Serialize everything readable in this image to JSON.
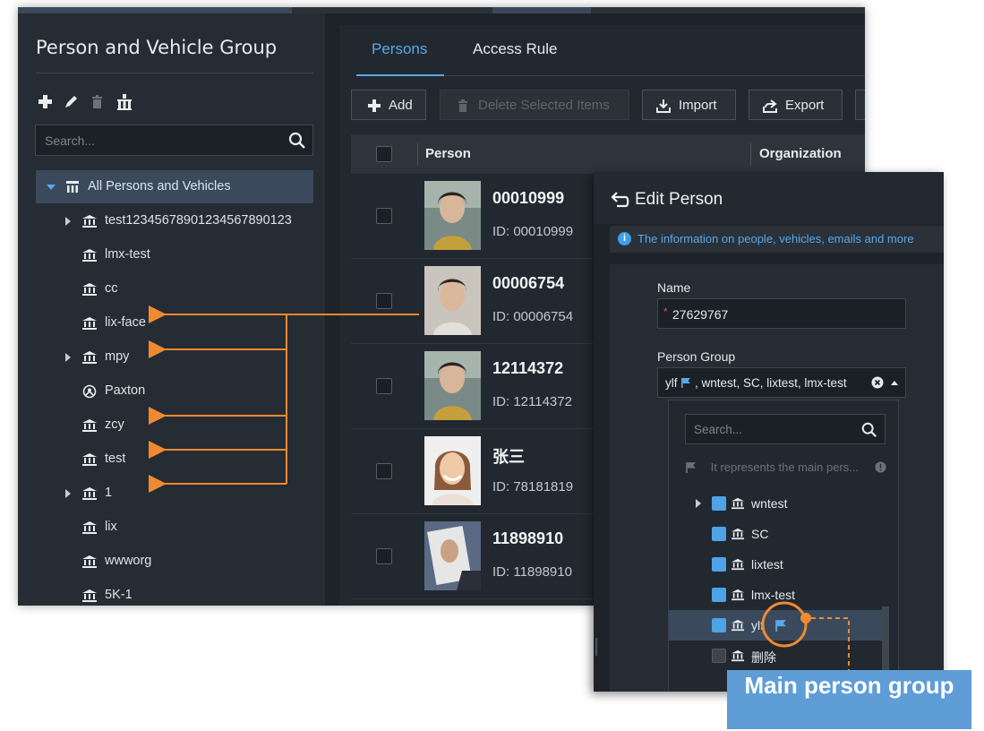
{
  "left_panel": {
    "title": "Person and Vehicle Group",
    "toolbar": [
      "add-icon",
      "edit-icon",
      "delete-icon",
      "organization-icon"
    ],
    "search_placeholder": "Search...",
    "tree": [
      {
        "label": "All Persons and Vehicles",
        "icon": "org-tree-icon",
        "expanded": true,
        "selected": true
      },
      {
        "label": "test12345678901234567890123",
        "icon": "building-icon",
        "has_children": true
      },
      {
        "label": "lmx-test",
        "icon": "building-icon"
      },
      {
        "label": "cc",
        "icon": "building-icon"
      },
      {
        "label": "lix-face",
        "icon": "building-icon"
      },
      {
        "label": "mpy",
        "icon": "building-icon",
        "has_children": true
      },
      {
        "label": "Paxton",
        "icon": "paxton-icon"
      },
      {
        "label": "zcy",
        "icon": "building-icon"
      },
      {
        "label": "test",
        "icon": "building-icon"
      },
      {
        "label": "1",
        "icon": "building-icon",
        "has_children": true
      },
      {
        "label": "lix",
        "icon": "building-icon"
      },
      {
        "label": "wwworg",
        "icon": "building-icon"
      },
      {
        "label": "5K-1",
        "icon": "building-icon"
      }
    ]
  },
  "tabs": {
    "persons": "Persons",
    "access_rule": "Access Rule"
  },
  "toolbar": {
    "add": "Add",
    "delete_selected": "Delete Selected Items",
    "import": "Import",
    "export": "Export"
  },
  "table": {
    "columns": {
      "person": "Person",
      "organization": "Organization"
    },
    "rows": [
      {
        "name": "00010999",
        "id": "ID: 00010999"
      },
      {
        "name": "00006754",
        "id": "ID: 00006754"
      },
      {
        "name": "12114372",
        "id": "ID: 12114372"
      },
      {
        "name": "张三",
        "id": "ID: 78181819"
      },
      {
        "name": "11898910",
        "id": "ID: 11898910"
      }
    ]
  },
  "edit_person": {
    "title": "Edit Person",
    "info": "The information on people, vehicles, emails and more",
    "name_label": "Name",
    "name_value": "27629767",
    "group_label": "Person Group",
    "group_value": "ylf",
    "group_value_rest": ", wntest, SC, lixtest, lmx-test",
    "dropdown_search_placeholder": "Search...",
    "dropdown_hint": "It represents the main pers...",
    "dropdown_items": [
      {
        "label": "wntest",
        "checked": true,
        "has_children": true
      },
      {
        "label": "SC",
        "checked": true
      },
      {
        "label": "lixtest",
        "checked": true
      },
      {
        "label": "lmx-test",
        "checked": true
      },
      {
        "label": "ylf",
        "checked": true,
        "main": true,
        "highlighted": true
      },
      {
        "label": "删除",
        "checked": false
      }
    ]
  },
  "annotation": {
    "label": "Main person group"
  },
  "colors": {
    "accent": "#5aa8e6",
    "annotation_arrow": "#f08a30",
    "annotation_box": "#5e9dd6"
  }
}
